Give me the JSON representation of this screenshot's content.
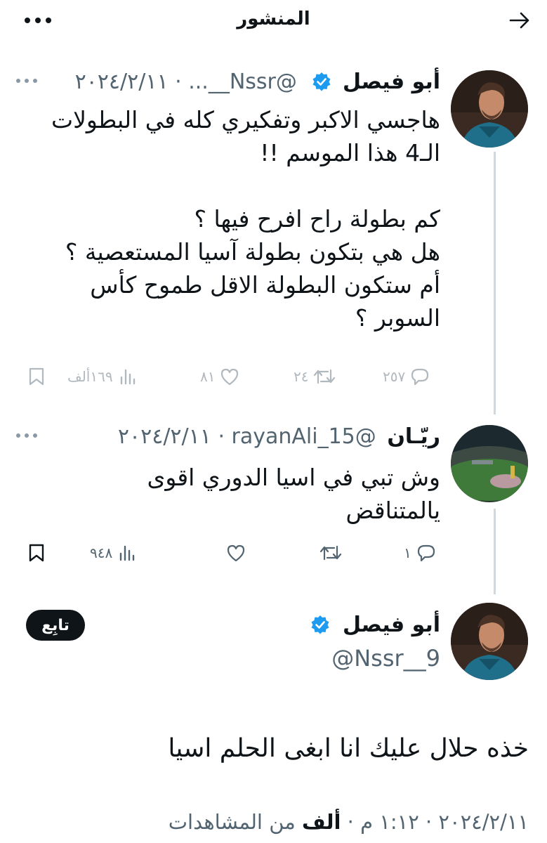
{
  "header": {
    "title": "المنشور",
    "back_icon": "arrow-right-icon",
    "more_icon": "more-horizontal-icon"
  },
  "posts": [
    {
      "name": "أبو فيصل",
      "verified": true,
      "handle": "@Nssr__...",
      "date": "٢٠٢٤/٢/١١",
      "separator": "·",
      "text": "هاجسي الاكبر وتفكيري كله في البطولات\nالـ4 هذا الموسم !!\n\nكم بطولة راح افرح فيها ؟\nهل هي بتكون بطولة آسيا المستعصية ؟\nأم ستكون البطولة الاقل طموح كأس\nالسوبر ؟",
      "replies": "٢٥٧",
      "reposts": "٢٤",
      "likes": "٨١",
      "views": "١٦٩ألف"
    },
    {
      "name": "ريّـان",
      "verified": false,
      "handle": "@rayanAli_15",
      "date": "٢٠٢٤/٢/١١",
      "separator": "·",
      "text": "وش تبي في اسيا الدوري اقوى\nيالمتناقض",
      "replies": "١",
      "reposts": "",
      "likes": "",
      "views": "٩٤٨"
    }
  ],
  "focused": {
    "name": "أبو فيصل",
    "verified": true,
    "handle": "@Nssr__9",
    "follow_label": "تابِع",
    "text": "خذه حلال عليك انا ابغى الحلم اسيا",
    "date": "٢٠٢٤/٢/١١",
    "time": "١:١٢ م",
    "views_count": "ألف",
    "views_label": "من المشاهدات",
    "separator": "·"
  },
  "colors": {
    "text": "#0f1419",
    "muted": "#536471",
    "verified_blue": "#1d9bf0",
    "thread_line": "#cfd9de"
  }
}
